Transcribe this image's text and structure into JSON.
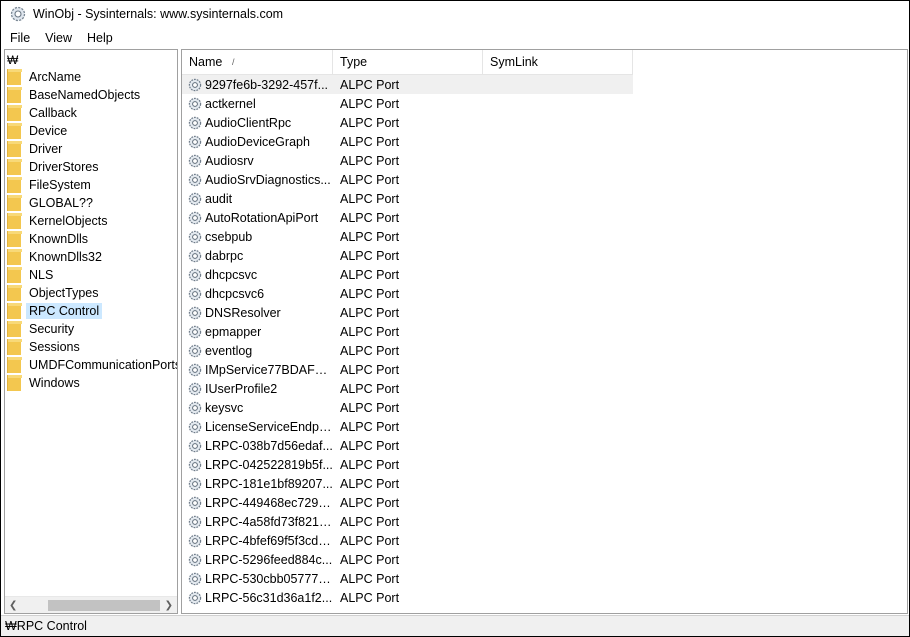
{
  "window": {
    "title": "WinObj - Sysinternals: www.sysinternals.com",
    "icon": "gear-icon"
  },
  "menubar": {
    "items": [
      {
        "label": "File"
      },
      {
        "label": "View"
      },
      {
        "label": "Help"
      }
    ]
  },
  "tree": {
    "root": "₩",
    "selected": "RPC Control",
    "items": [
      {
        "label": "ArcName"
      },
      {
        "label": "BaseNamedObjects"
      },
      {
        "label": "Callback"
      },
      {
        "label": "Device"
      },
      {
        "label": "Driver"
      },
      {
        "label": "DriverStores"
      },
      {
        "label": "FileSystem"
      },
      {
        "label": "GLOBAL??"
      },
      {
        "label": "KernelObjects"
      },
      {
        "label": "KnownDlls"
      },
      {
        "label": "KnownDlls32"
      },
      {
        "label": "NLS"
      },
      {
        "label": "ObjectTypes"
      },
      {
        "label": "RPC Control"
      },
      {
        "label": "Security"
      },
      {
        "label": "Sessions"
      },
      {
        "label": "UMDFCommunicationPorts"
      },
      {
        "label": "Windows"
      }
    ]
  },
  "list": {
    "columns": [
      {
        "label": "Name"
      },
      {
        "label": "Type"
      },
      {
        "label": "SymLink"
      }
    ],
    "sort_indicator": "/",
    "rows": [
      {
        "name": "9297fe6b-3292-457f...",
        "type": "ALPC Port"
      },
      {
        "name": "actkernel",
        "type": "ALPC Port"
      },
      {
        "name": "AudioClientRpc",
        "type": "ALPC Port"
      },
      {
        "name": "AudioDeviceGraph",
        "type": "ALPC Port"
      },
      {
        "name": "Audiosrv",
        "type": "ALPC Port"
      },
      {
        "name": "AudioSrvDiagnostics...",
        "type": "ALPC Port"
      },
      {
        "name": "audit",
        "type": "ALPC Port"
      },
      {
        "name": "AutoRotationApiPort",
        "type": "ALPC Port"
      },
      {
        "name": "csebpub",
        "type": "ALPC Port"
      },
      {
        "name": "dabrpc",
        "type": "ALPC Port"
      },
      {
        "name": "dhcpcsvc",
        "type": "ALPC Port"
      },
      {
        "name": "dhcpcsvc6",
        "type": "ALPC Port"
      },
      {
        "name": "DNSResolver",
        "type": "ALPC Port"
      },
      {
        "name": "epmapper",
        "type": "ALPC Port"
      },
      {
        "name": "eventlog",
        "type": "ALPC Port"
      },
      {
        "name": "IMpService77BDAF73...",
        "type": "ALPC Port"
      },
      {
        "name": "IUserProfile2",
        "type": "ALPC Port"
      },
      {
        "name": "keysvc",
        "type": "ALPC Port"
      },
      {
        "name": "LicenseServiceEndpoint",
        "type": "ALPC Port"
      },
      {
        "name": "LRPC-038b7d56edaf...",
        "type": "ALPC Port"
      },
      {
        "name": "LRPC-042522819b5f...",
        "type": "ALPC Port"
      },
      {
        "name": "LRPC-181e1bf89207...",
        "type": "ALPC Port"
      },
      {
        "name": "LRPC-449468ec7292...",
        "type": "ALPC Port"
      },
      {
        "name": "LRPC-4a58fd73f8212...",
        "type": "ALPC Port"
      },
      {
        "name": "LRPC-4bfef69f5f3cde...",
        "type": "ALPC Port"
      },
      {
        "name": "LRPC-5296feed884c...",
        "type": "ALPC Port"
      },
      {
        "name": "LRPC-530cbb057775...",
        "type": "ALPC Port"
      },
      {
        "name": "LRPC-56c31d36a1f2...",
        "type": "ALPC Port"
      }
    ]
  },
  "statusbar": {
    "text": "₩RPC Control"
  },
  "colors": {
    "selection": "#cce8ff",
    "folder": "#f3c74f",
    "hover_row": "#f0f0f0"
  }
}
